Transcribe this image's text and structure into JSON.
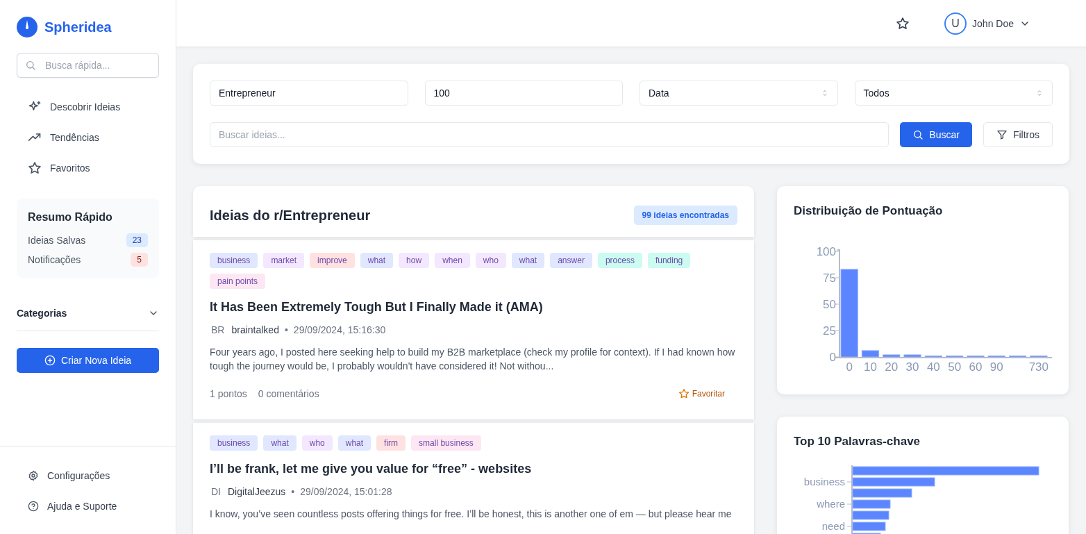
{
  "brand": {
    "name": "Spheridea"
  },
  "sidebar": {
    "search": {
      "placeholder": "Busca rápida..."
    },
    "nav": [
      {
        "label": "Descobrir Ideias"
      },
      {
        "label": "Tendências"
      },
      {
        "label": "Favoritos"
      }
    ],
    "summary": {
      "title": "Resumo Rápido",
      "items": [
        {
          "label": "Ideias Salvas",
          "count": "23",
          "color": "#dbeafe"
        },
        {
          "label": "Notificações",
          "count": "5",
          "color": "#fee2e2"
        }
      ]
    },
    "categories": {
      "label": "Categorias",
      "expanded": false
    },
    "create_button": "Criar Nova Ideia",
    "footer": [
      {
        "label": "Configurações"
      },
      {
        "label": "Ajuda e Suporte"
      }
    ]
  },
  "header": {
    "user": {
      "initial": "U",
      "name": "John Doe"
    }
  },
  "filters": {
    "subreddit": "Entrepreneur",
    "limit": "100",
    "sort": "Data",
    "period": "Todos",
    "search": {
      "placeholder": "Buscar ideias..."
    },
    "search_button": "Buscar",
    "filter_button": "Filtros"
  },
  "posts_panel": {
    "title": "Ideias do r/Entrepreneur",
    "count_badge": "99 ideias encontradas",
    "posts": [
      {
        "tags": [
          {
            "label": "business",
            "color": "#e0e7ff"
          },
          {
            "label": "market",
            "color": "#f3e8ff"
          },
          {
            "label": "improve",
            "color": "#fee2e2"
          },
          {
            "label": "what",
            "color": "#e0e7ff"
          },
          {
            "label": "how",
            "color": "#f3e8ff"
          },
          {
            "label": "when",
            "color": "#f3e8ff"
          },
          {
            "label": "who",
            "color": "#f3e8ff"
          },
          {
            "label": "what",
            "color": "#e0e7ff"
          },
          {
            "label": "answer",
            "color": "#e0e7ff"
          },
          {
            "label": "process",
            "color": "#ccfbf1"
          },
          {
            "label": "funding",
            "color": "#ccfbf1"
          },
          {
            "label": "pain points",
            "color": "#fce7f3"
          }
        ],
        "title": "It Has Been Extremely Tough But I Finally Made it (AMA)",
        "initials": "BR",
        "author": "braintalked",
        "separator": "•",
        "date": "29/09/2024, 15:16:30",
        "excerpt": "Four years ago, I posted here seeking help to build my B2B marketplace (check my profile for context). If I had known how tough the journey would be, I probably wouldn't have considered it! Not withou...",
        "points": "1 pontos",
        "comments": "0 comentários",
        "favorite_label": "Favoritar"
      },
      {
        "tags": [
          {
            "label": "business",
            "color": "#e0e7ff"
          },
          {
            "label": "what",
            "color": "#e0e7ff"
          },
          {
            "label": "who",
            "color": "#f3e8ff"
          },
          {
            "label": "what",
            "color": "#e0e7ff"
          },
          {
            "label": "firm",
            "color": "#fee2e2"
          },
          {
            "label": "small business",
            "color": "#fce7f3"
          }
        ],
        "title": "I’ll be frank, let me give you value for “free” - websites",
        "initials": "DI",
        "author": "DigitalJeezus",
        "separator": "•",
        "date": "29/09/2024, 15:01:28",
        "excerpt": "I know, you’ve seen countless posts offering things for free. I’ll be honest, this is another one of em — but please hear me"
      }
    ]
  },
  "score_chart": {
    "title": "Distribuição de Pontuação",
    "chart_data": {
      "type": "bar",
      "categories": [
        "0",
        "10",
        "20",
        "30",
        "40",
        "50",
        "60",
        "90",
        null,
        "730"
      ],
      "series": [
        {
          "color": "#5b86ff",
          "values": [
            83,
            6,
            2,
            2,
            1,
            1,
            1,
            1,
            1,
            1
          ]
        }
      ],
      "ylim": [
        0,
        100
      ],
      "yticks": [
        0,
        25,
        50,
        75,
        100
      ]
    }
  },
  "keywords_chart": {
    "title": "Top 10 Palavras-chave",
    "labels": [
      "business",
      "where",
      "need"
    ]
  }
}
